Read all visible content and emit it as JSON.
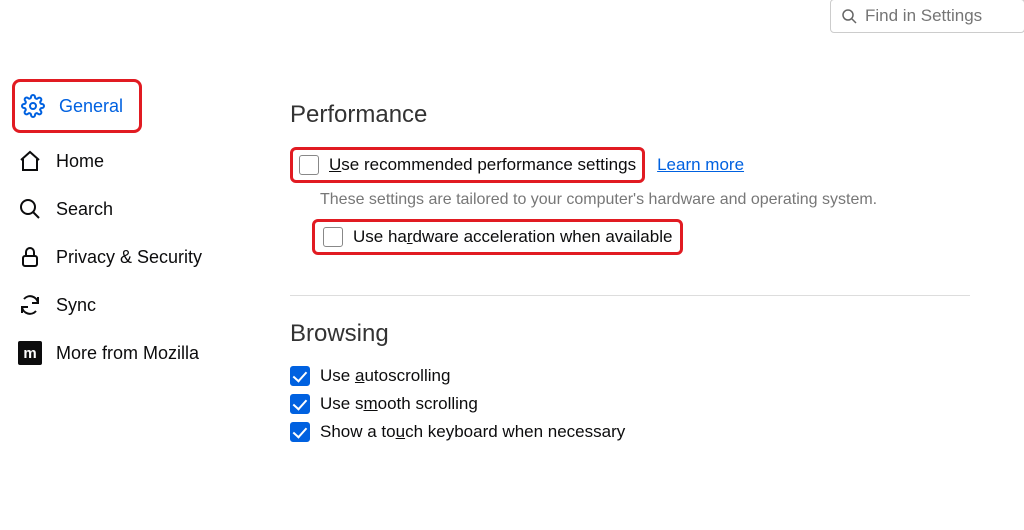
{
  "search": {
    "placeholder": "Find in Settings"
  },
  "sidebar": {
    "items": [
      {
        "label": "General"
      },
      {
        "label": "Home"
      },
      {
        "label": "Search"
      },
      {
        "label": "Privacy & Security"
      },
      {
        "label": "Sync"
      },
      {
        "label": "More from Mozilla"
      }
    ]
  },
  "performance": {
    "title": "Performance",
    "recommended_label_pre": "",
    "recommended_label": "Use recommended performance settings",
    "learn_more": "Learn more",
    "note": "These settings are tailored to your computer's hardware and operating system.",
    "hw_accel_label": "Use hardware acceleration when available"
  },
  "browsing": {
    "title": "Browsing",
    "autoscroll_label": "Use autoscrolling",
    "smooth_label": "Use smooth scrolling",
    "touchkbd_label": "Show a touch keyboard when necessary"
  }
}
